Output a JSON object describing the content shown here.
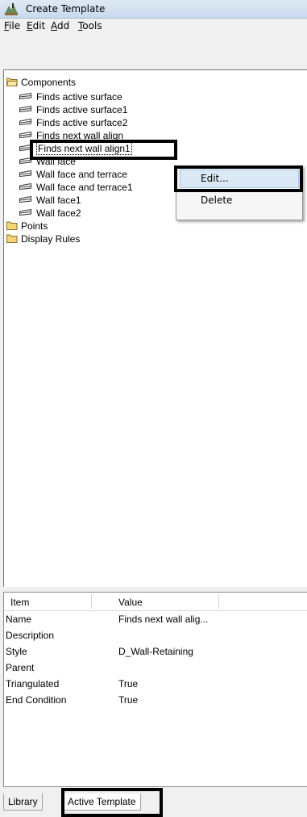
{
  "window": {
    "title": "Create Template"
  },
  "menu": [
    {
      "label": "File",
      "key": "F",
      "rest": "ile"
    },
    {
      "label": "Edit",
      "key": "E",
      "rest": "dit"
    },
    {
      "label": "Add",
      "key": "A",
      "rest": "dd"
    },
    {
      "label": "Tools",
      "key": "T",
      "rest": "ools"
    }
  ],
  "tree": {
    "components_label": "Components",
    "components": [
      "Finds active surface",
      "Finds active surface1",
      "Finds active surface2",
      "Finds next wall align",
      "Finds next wall align1",
      "Wall face",
      "Wall face and terrace",
      "Wall face and terrace1",
      "Wall face1",
      "Wall face2"
    ],
    "points_label": "Points",
    "display_rules_label": "Display Rules"
  },
  "context_menu": {
    "edit": "Edit...",
    "delete": "Delete"
  },
  "properties": {
    "col_item": "Item",
    "col_value": "Value",
    "rows": [
      {
        "item": "Name",
        "value": "Finds next wall alig..."
      },
      {
        "item": "Description",
        "value": ""
      },
      {
        "item": "Style",
        "value": "D_Wall-Retaining"
      },
      {
        "item": "Parent",
        "value": ""
      },
      {
        "item": "Triangulated",
        "value": "True"
      },
      {
        "item": "End Condition",
        "value": "True"
      }
    ]
  },
  "tabs": {
    "library": "Library",
    "active_template": "Active Template"
  },
  "colors": {
    "selection_hover": "#dbe8f5",
    "folder": "#f3d57a",
    "highlight_box": "#000000"
  }
}
